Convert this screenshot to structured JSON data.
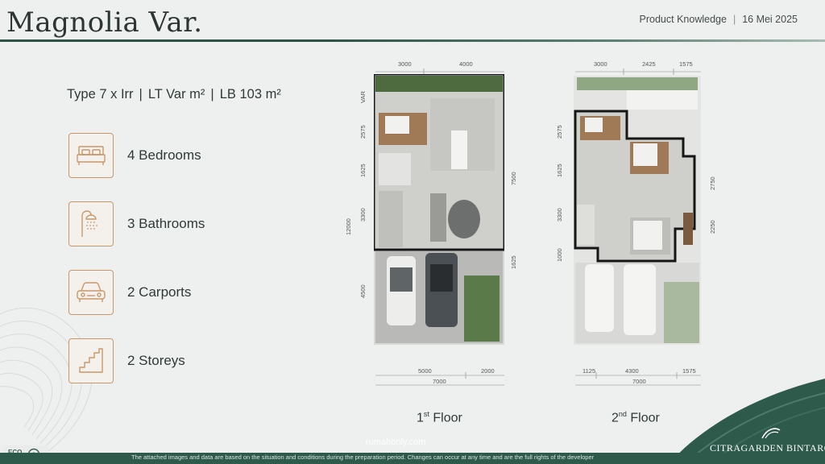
{
  "header": {
    "title": "Magnolia Var.",
    "subtitle": "Product Knowledge",
    "separator": "|",
    "date": "16 Mei 2025"
  },
  "specs": {
    "type": "Type 7 x Irr",
    "lt": "LT Var m²",
    "lb": "LB 103 m²",
    "separator": "|"
  },
  "features": [
    {
      "icon": "bed-icon",
      "label": "4 Bedrooms"
    },
    {
      "icon": "shower-icon",
      "label": "3 Bathrooms"
    },
    {
      "icon": "car-icon",
      "label": "2 Carports"
    },
    {
      "icon": "stairs-icon",
      "label": "2 Storeys"
    }
  ],
  "floor1": {
    "label_main": "1",
    "label_sup": "st",
    "label_rest": " Floor",
    "top_dims": [
      "3000",
      "4000"
    ],
    "left_dims": [
      "VAR",
      "2575",
      "1625",
      "3300",
      "4500"
    ],
    "left_total": "12000",
    "right_dims": [
      "7500",
      "1625"
    ],
    "bottom_dims": [
      "5000",
      "2000"
    ],
    "bottom_total": "7000"
  },
  "floor2": {
    "label_main": "2",
    "label_sup": "nd",
    "label_rest": " Floor",
    "top_dims": [
      "3000",
      "2425",
      "1575"
    ],
    "left_dims": [
      "2575",
      "1625",
      "3300",
      "1000"
    ],
    "right_dims": [
      "2750",
      "2250"
    ],
    "bottom_dims": [
      "1125",
      "4300",
      "1575"
    ],
    "bottom_total": "7000"
  },
  "footer": {
    "disclaimer": "The attached images and data are based on the situation and conditions during the preparation period. Changes can occur at any time and are the full rights of the developer",
    "brand": "CITRAGARDEN BINTARO",
    "watermark": "rumahonly.com",
    "eco": "ECO"
  },
  "colors": {
    "accent": "#c9976a",
    "brand_green": "#2e5a4b"
  }
}
